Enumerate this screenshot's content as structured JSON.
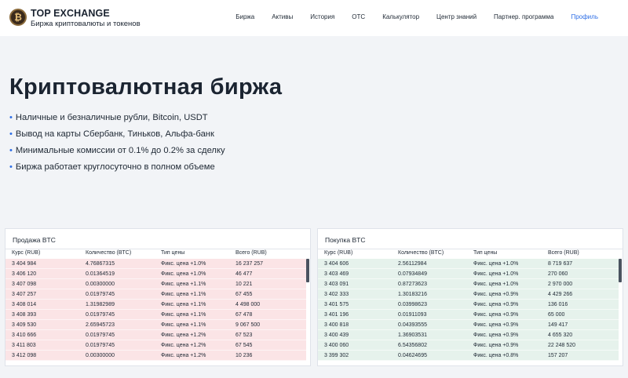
{
  "header": {
    "logo_glyph": "₿",
    "brand_title": "TOP EXCHANGE",
    "brand_subtitle": "Биржа криптовалюты и токенов",
    "nav": [
      "Биржа",
      "Активы",
      "История",
      "OTC",
      "Калькулятор",
      "Центр знаний",
      "Партнер. программа",
      "Профиль"
    ],
    "nav_active_index": 7,
    "accent_color": "#2d6ee6"
  },
  "hero": {
    "title": "Криптовалютная биржа",
    "bullet": "•",
    "features": [
      "Наличные и безналичные рубли, Bitcoin, USDT",
      "Вывод на карты Сбербанк, Тиньков, Альфа-банк",
      "Минимальные комиссии от 0.1% до 0.2% за сделку",
      "Биржа работает круглосуточно в полном объеме"
    ]
  },
  "sell": {
    "title": "Продажа BTC",
    "row_color": "#fbe4e6",
    "columns": [
      "Курс (RUB)",
      "Количество (BTC)",
      "Тип цены",
      "Всего (RUB)"
    ],
    "rows": [
      [
        "3 404 984",
        "4.76867315",
        "Фикс. цена +1.0%",
        "16 237 257"
      ],
      [
        "3 406 120",
        "0.01364519",
        "Фикс. цена +1.0%",
        "46 477"
      ],
      [
        "3 407 098",
        "0.00300000",
        "Фикс. цена +1.1%",
        "10 221"
      ],
      [
        "3 407 257",
        "0.01979745",
        "Фикс. цена +1.1%",
        "67 455"
      ],
      [
        "3 408 014",
        "1.31982989",
        "Фикс. цена +1.1%",
        "4 498 000"
      ],
      [
        "3 408 393",
        "0.01979745",
        "Фикс. цена +1.1%",
        "67 478"
      ],
      [
        "3 409 530",
        "2.65945723",
        "Фикс. цена +1.1%",
        "9 067 500"
      ],
      [
        "3 410 666",
        "0.01979745",
        "Фикс. цена +1.2%",
        "67 523"
      ],
      [
        "3 411 803",
        "0.01979745",
        "Фикс. цена +1.2%",
        "67 545"
      ],
      [
        "3 412 098",
        "0.00300000",
        "Фикс. цена +1.2%",
        "10 236"
      ]
    ]
  },
  "buy": {
    "title": "Покупка BTC",
    "row_color": "#e6f2ec",
    "columns": [
      "Курс (RUB)",
      "Количество (BTC)",
      "Тип цены",
      "Всего (RUB)"
    ],
    "rows": [
      [
        "3 404 606",
        "2.56112984",
        "Фикс. цена +1.0%",
        "8 719 637"
      ],
      [
        "3 403 469",
        "0.07934849",
        "Фикс. цена +1.0%",
        "270 060"
      ],
      [
        "3 403 091",
        "0.87273623",
        "Фикс. цена +1.0%",
        "2 970 000"
      ],
      [
        "3 402 333",
        "1.30183216",
        "Фикс. цена +0.9%",
        "4 429 266"
      ],
      [
        "3 401 575",
        "0.03998623",
        "Фикс. цена +0.9%",
        "136 016"
      ],
      [
        "3 401 196",
        "0.01911093",
        "Фикс. цена +0.9%",
        "65 000"
      ],
      [
        "3 400 818",
        "0.04393555",
        "Фикс. цена +0.9%",
        "149 417"
      ],
      [
        "3 400 439",
        "1.36903531",
        "Фикс. цена +0.9%",
        "4 655 320"
      ],
      [
        "3 400 060",
        "6.54356802",
        "Фикс. цена +0.9%",
        "22 248 520"
      ],
      [
        "3 399 302",
        "0.04624695",
        "Фикс. цена +0.8%",
        "157 207"
      ]
    ]
  }
}
